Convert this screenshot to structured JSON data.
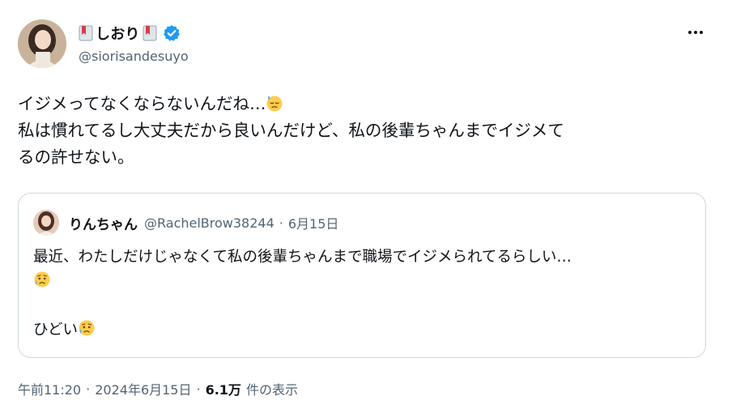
{
  "author": {
    "display_name": "しおり",
    "handle": "@siorisandesuyo",
    "verified": true
  },
  "tweet": {
    "lines": [
      "イジメってなくならないんだね…",
      "私は慣れてるし大丈夫だから良いんだけど、私の後輩ちゃんまでイジメて",
      "るの許せない。"
    ],
    "emoji": "downcast-face-with-sweat"
  },
  "quote": {
    "display_name": "りんちゃん",
    "handle": "@RachelBrow38244",
    "separator": "·",
    "date": "6月15日",
    "lines": [
      "最近、わたしだけじゃなくて私の後輩ちゃんまで職場でイジメられてるらしい…",
      "ひどい"
    ],
    "emoji": "sad-but-relieved-face"
  },
  "meta": {
    "time": "午前11:20",
    "separator": "·",
    "date": "2024年6月15日",
    "views_count": "6.1万",
    "views_label": "件の表示"
  },
  "colors": {
    "text": "#0f1419",
    "secondary": "#536471",
    "border": "#cfd9de",
    "verified": "#1d9bf0"
  }
}
